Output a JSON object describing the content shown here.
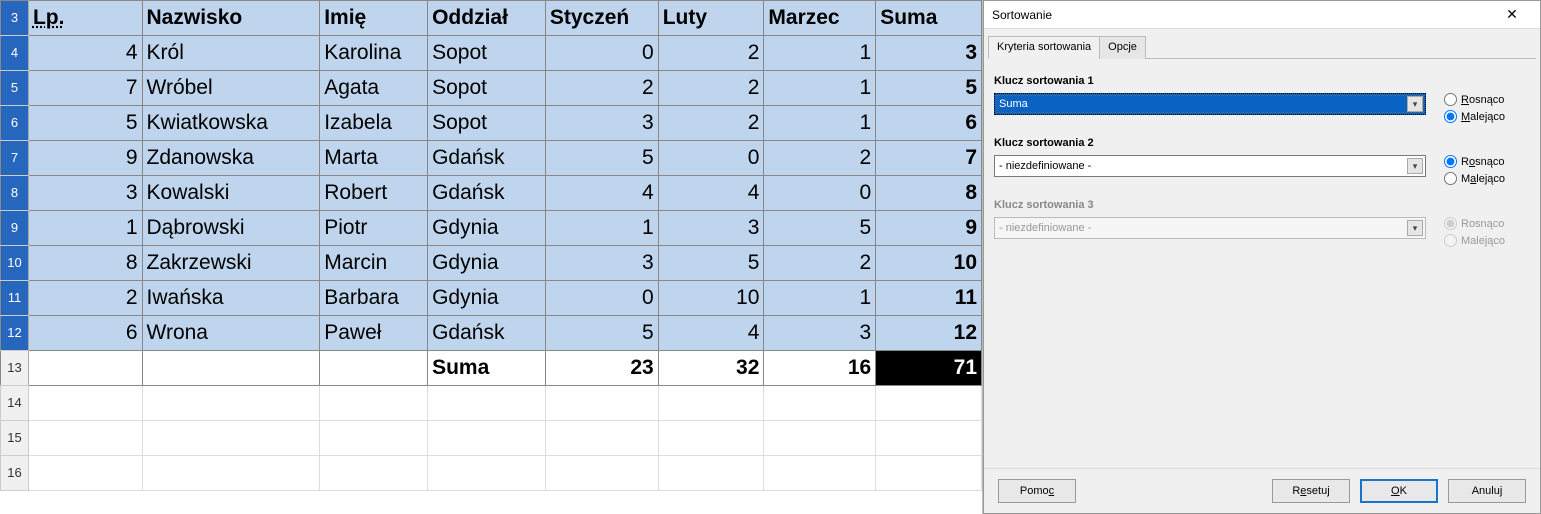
{
  "headers": {
    "lp": "Lp.",
    "nazwisko": "Nazwisko",
    "imie": "Imię",
    "oddzial": "Oddział",
    "styczen": "Styczeń",
    "luty": "Luty",
    "marzec": "Marzec",
    "suma": "Suma"
  },
  "rows": [
    {
      "n": "4",
      "lp": "4",
      "nazw": "Król",
      "imie": "Karolina",
      "odd": "Sopot",
      "sty": "0",
      "lut": "2",
      "mar": "1",
      "sum": "3"
    },
    {
      "n": "5",
      "lp": "7",
      "nazw": "Wróbel",
      "imie": "Agata",
      "odd": "Sopot",
      "sty": "2",
      "lut": "2",
      "mar": "1",
      "sum": "5"
    },
    {
      "n": "6",
      "lp": "5",
      "nazw": "Kwiatkowska",
      "imie": "Izabela",
      "odd": "Sopot",
      "sty": "3",
      "lut": "2",
      "mar": "1",
      "sum": "6"
    },
    {
      "n": "7",
      "lp": "9",
      "nazw": "Zdanowska",
      "imie": "Marta",
      "odd": "Gdańsk",
      "sty": "5",
      "lut": "0",
      "mar": "2",
      "sum": "7"
    },
    {
      "n": "8",
      "lp": "3",
      "nazw": "Kowalski",
      "imie": "Robert",
      "odd": "Gdańsk",
      "sty": "4",
      "lut": "4",
      "mar": "0",
      "sum": "8"
    },
    {
      "n": "9",
      "lp": "1",
      "nazw": "Dąbrowski",
      "imie": "Piotr",
      "odd": "Gdynia",
      "sty": "1",
      "lut": "3",
      "mar": "5",
      "sum": "9"
    },
    {
      "n": "10",
      "lp": "8",
      "nazw": "Zakrzewski",
      "imie": "Marcin",
      "odd": "Gdynia",
      "sty": "3",
      "lut": "5",
      "mar": "2",
      "sum": "10"
    },
    {
      "n": "11",
      "lp": "2",
      "nazw": "Iwańska",
      "imie": "Barbara",
      "odd": "Gdynia",
      "sty": "0",
      "lut": "10",
      "mar": "1",
      "sum": "11"
    },
    {
      "n": "12",
      "lp": "6",
      "nazw": "Wrona",
      "imie": "Paweł",
      "odd": "Gdańsk",
      "sty": "5",
      "lut": "4",
      "mar": "3",
      "sum": "12"
    }
  ],
  "sumrow": {
    "n": "13",
    "label": "Suma",
    "sty": "23",
    "lut": "32",
    "mar": "16",
    "sum": "71"
  },
  "emptyRows": [
    "14",
    "15",
    "16"
  ],
  "headerRowNum": "3",
  "dialog": {
    "title": "Sortowanie",
    "close": "✕",
    "tabs": {
      "criteria": "Kryteria sortowania",
      "options": "Opcje"
    },
    "keys": {
      "k1": {
        "label": "Klucz sortowania 1",
        "value": "Suma",
        "asc": "Rosnąco",
        "desc": "Malejąco"
      },
      "k2": {
        "label": "Klucz sortowania 2",
        "value": "- niezdefiniowane -",
        "asc": "Rosnąco",
        "desc": "Malejąco"
      },
      "k3": {
        "label": "Klucz sortowania 3",
        "value": "- niezdefiniowane -",
        "asc": "Rosnąco",
        "desc": "Malejąco"
      }
    },
    "buttons": {
      "help": "Pomoc",
      "reset": "Resetuj",
      "ok": "OK",
      "cancel": "Anuluj"
    },
    "accel": {
      "R": "R",
      "M": "M",
      "o": "o",
      "a": "a",
      "e": "e",
      "O_ok": "O"
    }
  }
}
